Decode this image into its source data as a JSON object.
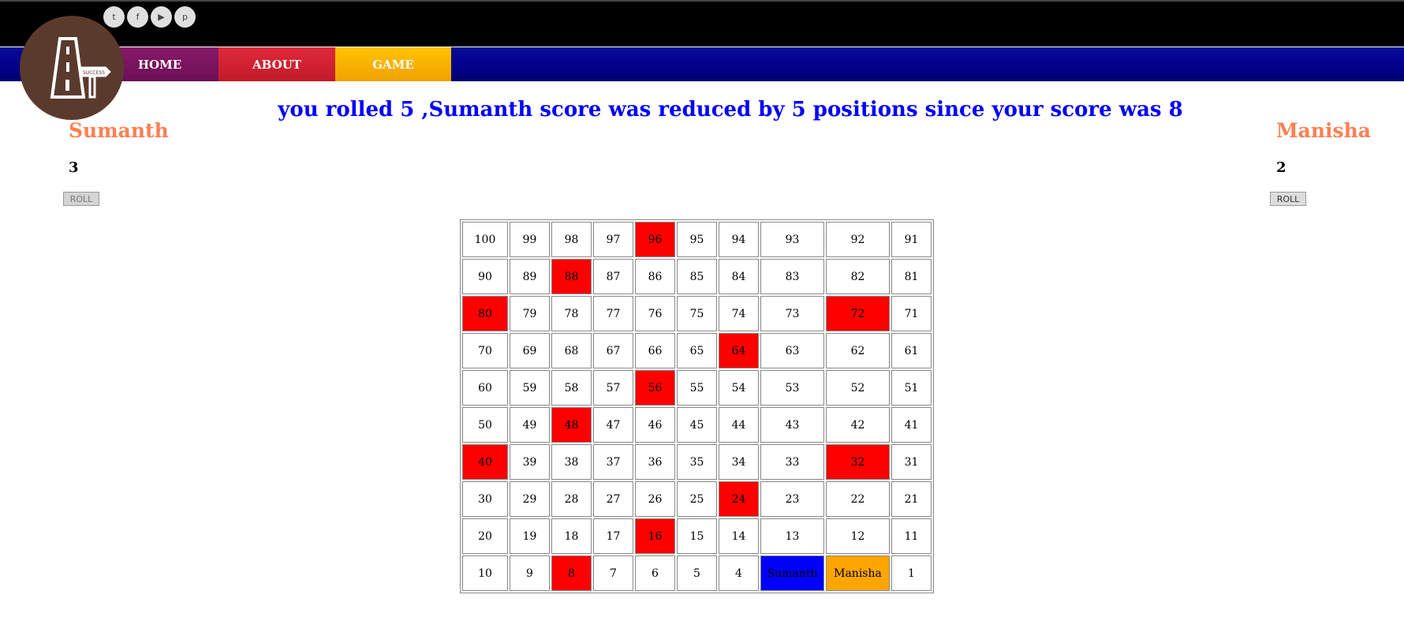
{
  "social": [
    {
      "icon": "twitter-icon",
      "glyph": "t"
    },
    {
      "icon": "facebook-icon",
      "glyph": "f"
    },
    {
      "icon": "youtube-icon",
      "glyph": "▶"
    },
    {
      "icon": "pinterest-icon",
      "glyph": "p"
    }
  ],
  "nav": {
    "home": "HOME",
    "about": "ABOUT",
    "game": "GAME"
  },
  "logo": {
    "icon": "road-sign-logo-icon",
    "sign_text": "SUCCESS"
  },
  "message": "you rolled 5 ,Sumanth score was reduced by 5 positions since your score was 8",
  "players": {
    "left": {
      "name": "Sumanth",
      "score": "3",
      "roll_label": "ROLL",
      "color": "#0000ff"
    },
    "right": {
      "name": "Manisha",
      "score": "2",
      "roll_label": "ROLL",
      "color": "#ffa500"
    }
  },
  "colors": {
    "snake": "#ff0000",
    "player1": "#0000ff",
    "player2": "#ffa500",
    "message": "#0000ff",
    "player_name": "#ff7f50"
  },
  "board": {
    "rows": [
      [
        "100",
        "99",
        "98",
        "97",
        "96",
        "95",
        "94",
        "93",
        "92",
        "91"
      ],
      [
        "90",
        "89",
        "88",
        "87",
        "86",
        "85",
        "84",
        "83",
        "82",
        "81"
      ],
      [
        "80",
        "79",
        "78",
        "77",
        "76",
        "75",
        "74",
        "73",
        "72",
        "71"
      ],
      [
        "70",
        "69",
        "68",
        "67",
        "66",
        "65",
        "64",
        "63",
        "62",
        "61"
      ],
      [
        "60",
        "59",
        "58",
        "57",
        "56",
        "55",
        "54",
        "53",
        "52",
        "51"
      ],
      [
        "50",
        "49",
        "48",
        "47",
        "46",
        "45",
        "44",
        "43",
        "42",
        "41"
      ],
      [
        "40",
        "39",
        "38",
        "37",
        "36",
        "35",
        "34",
        "33",
        "32",
        "31"
      ],
      [
        "30",
        "29",
        "28",
        "27",
        "26",
        "25",
        "24",
        "23",
        "22",
        "21"
      ],
      [
        "20",
        "19",
        "18",
        "17",
        "16",
        "15",
        "14",
        "13",
        "12",
        "11"
      ],
      [
        "10",
        "9",
        "8",
        "7",
        "6",
        "5",
        "4",
        "Sumanth",
        "Manisha",
        "1"
      ]
    ],
    "snake_cells": [
      "96",
      "88",
      "80",
      "72",
      "64",
      "56",
      "48",
      "40",
      "32",
      "24",
      "16",
      "8"
    ],
    "player1_cell": "Sumanth",
    "player2_cell": "Manisha"
  }
}
